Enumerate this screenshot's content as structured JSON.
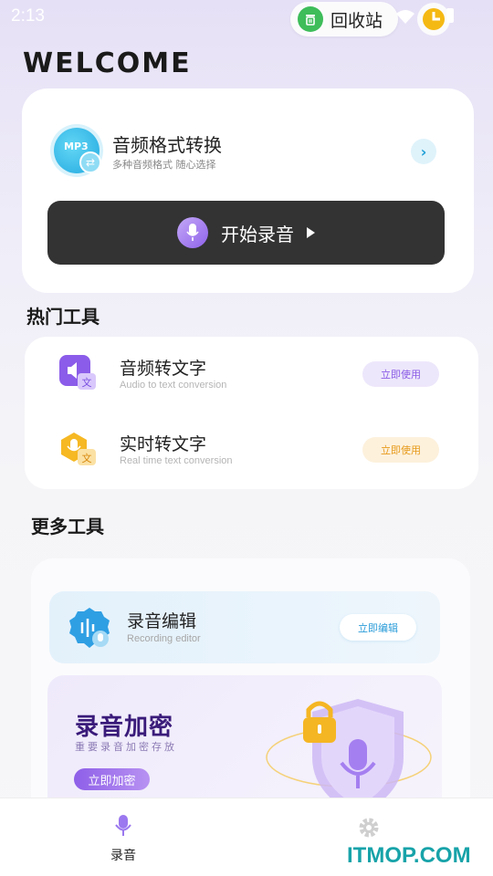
{
  "status_bar": {
    "time": "2:13",
    "recycle_label": "回收站"
  },
  "header": {
    "welcome": "WELCOME"
  },
  "converter": {
    "icon_text": "MP3",
    "title": "音频格式转换",
    "subtitle": "多种音频格式 随心选择",
    "record_button": "开始录音"
  },
  "hot_tools": {
    "title": "热门工具",
    "items": [
      {
        "title": "音频转文字",
        "subtitle": "Audio to text conversion",
        "button": "立即使用",
        "icon": "audio-to-text-icon",
        "accent": "#8a5ce6"
      },
      {
        "title": "实时转文字",
        "subtitle": "Real time text conversion",
        "button": "立即使用",
        "icon": "realtime-text-icon",
        "accent": "#e79a1a"
      }
    ]
  },
  "more_tools": {
    "title": "更多工具",
    "editor": {
      "title": "录音编辑",
      "subtitle": "Recording editor",
      "button": "立即编辑"
    },
    "encrypt": {
      "title": "录音加密",
      "subtitle": "重要录音加密存放",
      "button": "立即加密"
    }
  },
  "bottom_nav": {
    "items": [
      {
        "label": "录音",
        "icon": "microphone-icon",
        "active": true
      },
      {
        "label": "",
        "icon": "gear-icon",
        "active": false
      }
    ]
  },
  "watermark": "ITMOP.COM"
}
